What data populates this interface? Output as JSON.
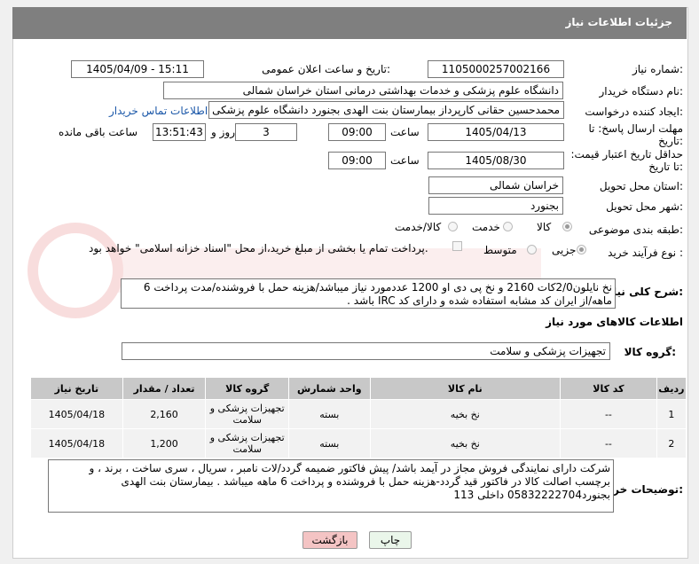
{
  "header": {
    "title": "جزئیات اطلاعات نیاز"
  },
  "form": {
    "need_number_label": "شماره نیاز:",
    "need_number": "1105000257002166",
    "announce_label": "تاریخ و ساعت اعلان عمومی:",
    "announce_value": "1405/04/09 - 15:11",
    "buyer_org_label": "نام دستگاه خریدار:",
    "buyer_org": "دانشگاه علوم پزشکی و خدمات بهداشتی درمانی استان خراسان شمالی",
    "creator_label": "ایجاد کننده درخواست:",
    "creator": "محمدحسین حقانی کارپرداز بیمارستان بنت الهدی بجنورد دانشگاه علوم پزشکی",
    "contact_link": "اطلاعات تماس خریدار",
    "deadline_label": "مهلت ارسال پاسخ: تا تاریخ:",
    "deadline_date": "1405/04/13",
    "time_label": "ساعت",
    "deadline_time": "09:00",
    "days": "3",
    "days_label": "روز و",
    "remaining_time": "13:51:43",
    "remaining_label": "ساعت باقی مانده",
    "validity_label": "حداقل تاریخ اعتبار قیمت: تا تاریخ:",
    "validity_date": "1405/08/30",
    "validity_time": "09:00",
    "province_label": "استان محل تحویل:",
    "province": "خراسان شمالی",
    "city_label": "شهر محل تحویل:",
    "city": "بجنورد",
    "category_label": "طبقه بندی موضوعی:",
    "category_options": [
      "کالا",
      "خدمت",
      "کالا/خدمت"
    ],
    "process_label": "نوع فرآیند خرید :",
    "process_options": [
      "جزیی",
      "متوسط"
    ],
    "payment_note": "پرداخت تمام یا بخشی از مبلغ خرید،از محل \"اسناد خزانه اسلامی\" خواهد بود.",
    "description_label": "شرح کلی نیاز:",
    "description": "نخ نایلون2/0کات 2160 و نخ پی دی او 1200 عددمورد نیاز میباشد/هزینه حمل با فروشنده/مدت پرداخت 6 ماهه/از ایران کد مشابه استفاده شده و دارای کد IRC باشد .",
    "goods_info_title": "اطلاعات کالاهای مورد نیاز",
    "goods_group_label": "گروه کالا:",
    "goods_group": "تجهیزات پزشکی و سلامت"
  },
  "table": {
    "headers": [
      "ردیف",
      "کد کالا",
      "نام کالا",
      "واحد شمارش",
      "گروه کالا",
      "تعداد / مقدار",
      "تاریخ نیاز"
    ],
    "rows": [
      [
        "1",
        "--",
        "نخ بخیه",
        "بسته",
        "تجهیزات پزشکی و سلامت",
        "2,160",
        "1405/04/18"
      ],
      [
        "2",
        "--",
        "نخ بخیه",
        "بسته",
        "تجهیزات پزشکی و سلامت",
        "1,200",
        "1405/04/18"
      ]
    ]
  },
  "buyer_notes_label": "توضیحات خریدار:",
  "buyer_notes": "شرکت دارای نمایندگی فروش مجاز در آیمد باشد/ پیش فاکتور ضمیمه گردد/لات نامبر ، سریال ، سری ساخت ، برند ، و برچسب اصالت کالا در فاکتور قید گردد-هزینه حمل با فروشنده و پرداخت 6 ماهه میباشد . بیمارستان بنت الهدی بجنورد05832222704 داخلی 113",
  "buttons": {
    "print": "چاپ",
    "back": "بازگشت"
  },
  "colors": {
    "header": "#7f7f7f",
    "link": "#1a57a8",
    "back_button": "#f4c4c4",
    "print_button": "#eaf6ea"
  }
}
